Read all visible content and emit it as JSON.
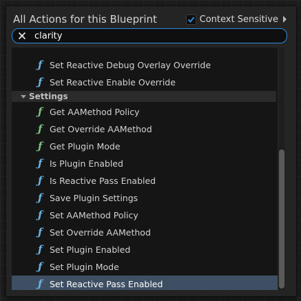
{
  "header": {
    "title": "All Actions for this Blueprint",
    "context_sensitive_label": "Context Sensitive",
    "context_sensitive_checked": true
  },
  "search": {
    "value": "clarity",
    "clear_icon": "close-icon"
  },
  "list": {
    "top_items": [
      {
        "label": "Set Reactive Debug Overlay Override",
        "icon": "function-icon"
      },
      {
        "label": "Set Reactive Enable Override",
        "icon": "function-icon"
      }
    ],
    "category": {
      "label": "Settings",
      "expanded": true
    },
    "items": [
      {
        "label": "Get AAMethod Policy",
        "icon": "pure-function-icon"
      },
      {
        "label": "Get Override AAMethod",
        "icon": "pure-function-icon"
      },
      {
        "label": "Get Plugin Mode",
        "icon": "pure-function-icon"
      },
      {
        "label": "Is Plugin Enabled",
        "icon": "function-icon"
      },
      {
        "label": "Is Reactive Pass Enabled",
        "icon": "function-icon"
      },
      {
        "label": "Save Plugin Settings",
        "icon": "function-icon"
      },
      {
        "label": "Set AAMethod Policy",
        "icon": "function-icon"
      },
      {
        "label": "Set Override AAMethod",
        "icon": "function-icon"
      },
      {
        "label": "Set Plugin Enabled",
        "icon": "function-icon"
      },
      {
        "label": "Set Plugin Mode",
        "icon": "function-icon"
      },
      {
        "label": "Set Reactive Pass Enabled",
        "icon": "function-icon",
        "selected": true
      }
    ],
    "function_glyph": "ƒ"
  },
  "colors": {
    "accent": "#2a8de0",
    "function_icon": "#6bb4e6",
    "pure_function_icon": "#7bc47f",
    "selection": "#3e4f63",
    "checkbox_check": "#2a8de0"
  }
}
